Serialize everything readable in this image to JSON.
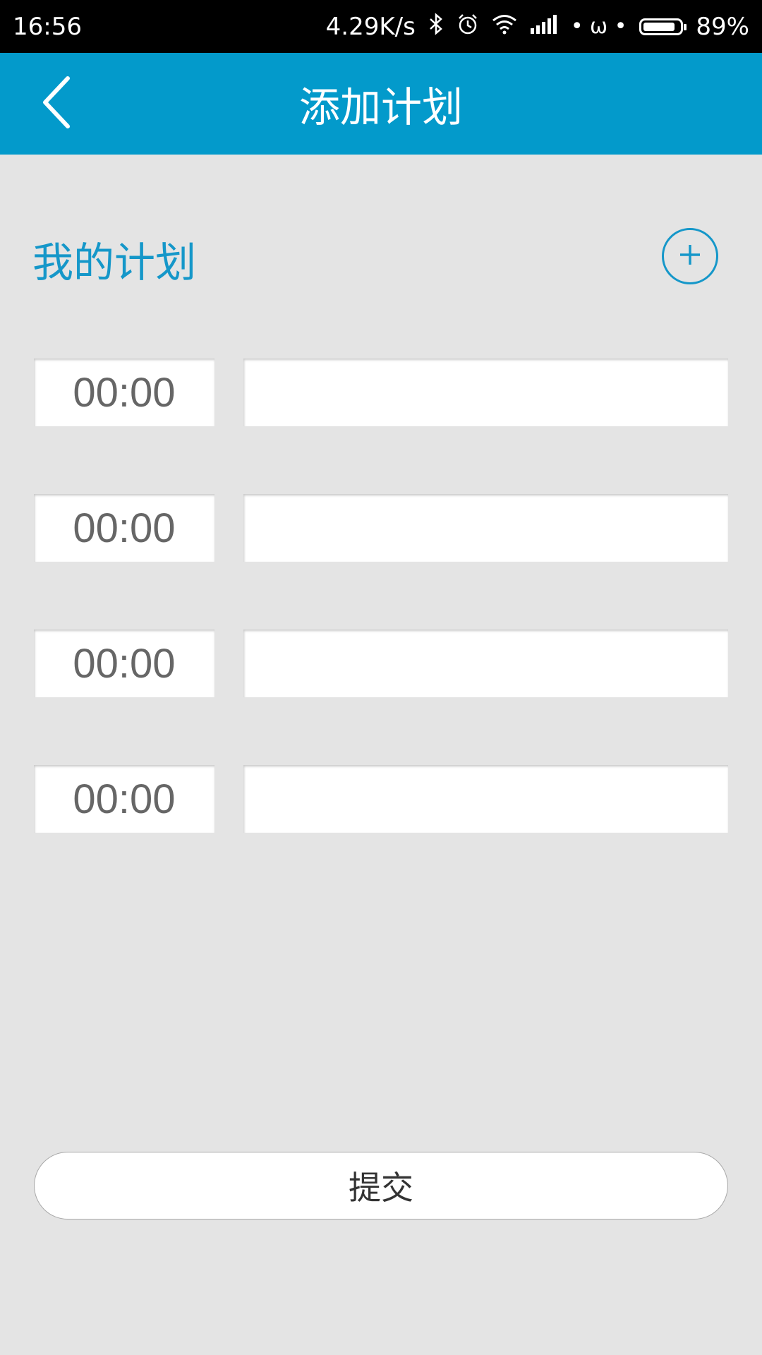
{
  "status_bar": {
    "time": "16:56",
    "network_speed": "4.29K/s",
    "battery_percent": "89%",
    "battery_level": 0.89,
    "icons": [
      "bluetooth-icon",
      "alarm-icon",
      "wifi-icon",
      "signal-icon",
      "omega-icon",
      "battery-icon"
    ]
  },
  "app_bar": {
    "title": "添加计划",
    "back_icon": "chevron-left-icon"
  },
  "section": {
    "title": "我的计划",
    "add_icon": "plus-circle-icon"
  },
  "plans": [
    {
      "time": "00:00",
      "text": ""
    },
    {
      "time": "00:00",
      "text": ""
    },
    {
      "time": "00:00",
      "text": ""
    },
    {
      "time": "00:00",
      "text": ""
    }
  ],
  "submit": {
    "label": "提交"
  },
  "colors": {
    "accent": "#039acb",
    "section_text": "#1597c9",
    "background": "#e4e4e4"
  }
}
